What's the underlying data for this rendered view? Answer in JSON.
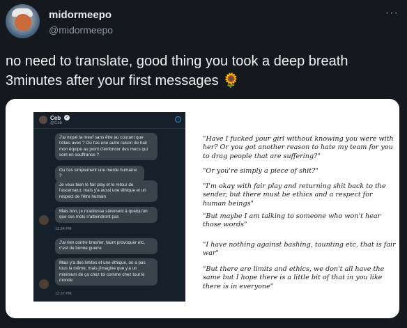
{
  "user": {
    "name": "midormeepo",
    "handle": "@midormeepo"
  },
  "tweet": {
    "text": "no need to translate, good thing you took a deep breath 3minutes after your first messages 🌻"
  },
  "dm": {
    "name": "Ceb",
    "handle": "@Ceb",
    "messages": [
      "J'ai niqué ta meuf sans être au courant que t'étais avec ? Ou t'as une autre raison de hair mon équipe au point d'enfoncer des mecs qui sont en souffrance ?",
      "Ou t'es simplement une merde humaine ?",
      "Je veux bien le fair play et le retour de l'ascenseur, mais y'a aussi une éthique et un respect de l'être humain",
      "Mais bon, je m'adresse sûrement à quelqu'un que ces mots n'atteindront pas",
      "J'ai rien contre brasher, taunt provoquer etc, c'est de bonne guerre",
      "Mais y'a des limites et une éthique, on a pas tous la même, mais j'imagine que y'a un minimum de ça chez toi comme chez tout le monde"
    ],
    "timestamps": [
      "12:34 PM",
      "12:37 PM"
    ]
  },
  "translations": [
    "\"Have I fucked your girl without knowing you were with her? Or you got another reason to hate my team for you to drag people that are suffering?\"",
    "\"Or you're simply a piece of shit?\"",
    "\"I'm okay with fair play and returning shit back to the sender, but there must be ethics and a respect for human beings\"",
    "\"But maybe I am talking to someone who won't hear those words\"",
    "\"I have nothing against bashing, taunting etc, that is fair war\"",
    "\"But there are limits and ethics, we don't all have the same but I hope there is a little bit of that in you like there is in everyone\""
  ]
}
